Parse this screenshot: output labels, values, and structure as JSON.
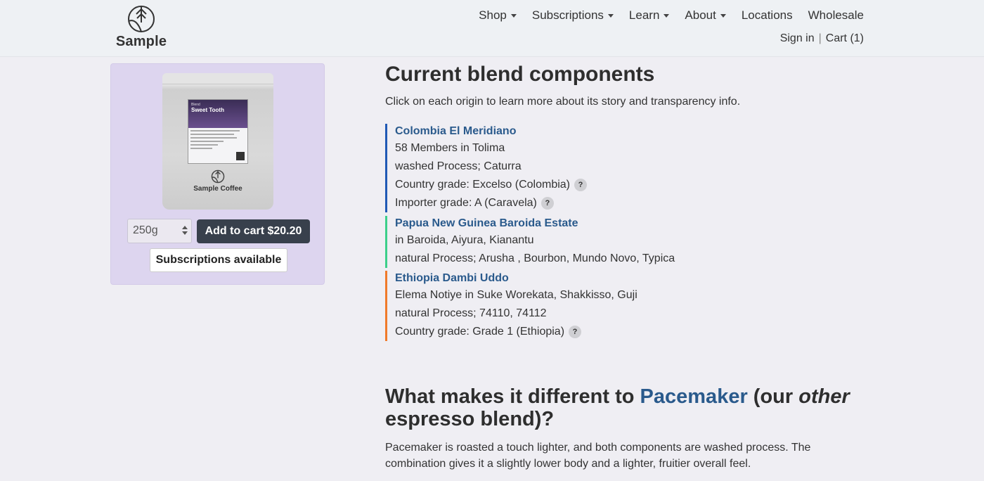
{
  "header": {
    "logo_text": "Sample",
    "nav": [
      {
        "label": "Shop",
        "dropdown": true
      },
      {
        "label": "Subscriptions",
        "dropdown": true
      },
      {
        "label": "Learn",
        "dropdown": true
      },
      {
        "label": "About",
        "dropdown": true
      },
      {
        "label": "Locations",
        "dropdown": false
      },
      {
        "label": "Wholesale",
        "dropdown": false
      }
    ],
    "sign_in": "Sign in",
    "separator": "|",
    "cart": "Cart (1)"
  },
  "product": {
    "bag_label_kind": "Blend",
    "bag_label_name": "Sweet Tooth",
    "bag_brand": "Sample Coffee",
    "size_selected": "250g",
    "add_to_cart": "Add to cart $20.20",
    "subscriptions": "Subscriptions available",
    "card_color": "#ddd5ef"
  },
  "blend": {
    "title": "Current blend components",
    "intro": "Click on each origin to learn more about its story and transparency info.",
    "help_symbol": "?",
    "origins": [
      {
        "name": "Colombia El Meridiano",
        "color": "#2059b5",
        "lines": [
          "58 Members in Tolima",
          "washed Process; Caturra",
          "Country grade: Excelso (Colombia)",
          "Importer grade: A (Caravela)"
        ]
      },
      {
        "name": "Papua New Guinea Baroida Estate",
        "color": "#3ccf8a",
        "lines": [
          "in Baroida, Aiyura, Kianantu",
          "natural Process; Arusha , Bourbon, Mundo Novo, Typica"
        ]
      },
      {
        "name": "Ethiopia Dambi Uddo",
        "color": "#f07a2a",
        "lines": [
          "Elema Notiye in Suke Worekata, Shakkisso, Guji",
          "natural Process; 74110, 74112",
          "Country grade: Grade 1 (Ethiopia)"
        ]
      }
    ]
  },
  "difference": {
    "title_pre": "What makes it different to ",
    "title_link": "Pacemaker",
    "title_mid": " (our ",
    "title_em": "other",
    "title_post": " espresso blend)?",
    "body": "Pacemaker is roasted a touch lighter, and both components are washed process. The combination gives it a slightly lower body and a lighter, fruitier overall feel."
  }
}
